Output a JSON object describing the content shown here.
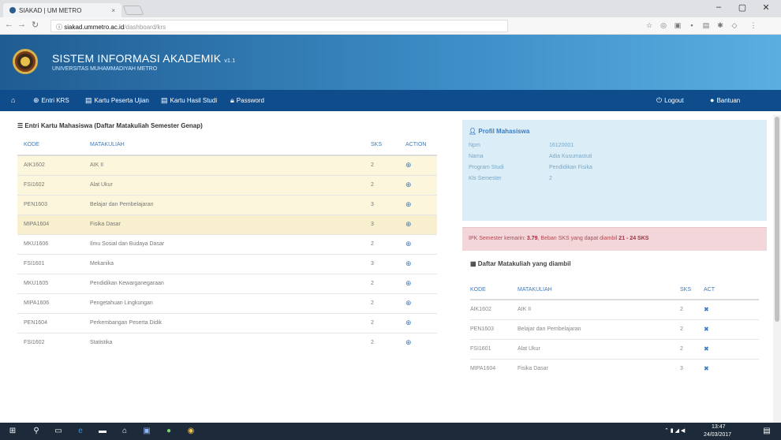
{
  "browser": {
    "tab_title": "SIAKAD | UM METRO",
    "tab_close": "×",
    "url_host": "siakad.ummetro.ac.id",
    "url_path": "/dashboard/krs",
    "win_min": "–",
    "win_max": "▢",
    "win_close": "✕"
  },
  "header": {
    "title": "SISTEM INFORMASI AKADEMIK",
    "version": "v1.1",
    "subtitle": "UNIVERSITAS MUHAMMADIYAH METRO"
  },
  "nav": {
    "home_icon": "home-icon",
    "items": [
      {
        "label": "Entri KRS",
        "icon": "plus-circle-icon"
      },
      {
        "label": "Kartu Peserta Ujian",
        "icon": "card-icon"
      },
      {
        "label": "Kartu Hasil Studi",
        "icon": "card-icon"
      },
      {
        "label": "Password",
        "icon": "lock-icon"
      }
    ],
    "right_items": [
      {
        "label": "Logout",
        "icon": "logout-icon"
      },
      {
        "label": "Bantuan",
        "icon": "help-icon"
      }
    ]
  },
  "krs_panel": {
    "title": "Entri Kartu Mahasiswa (Daftar Matakuliah Semester Genap)",
    "columns": [
      "KODE",
      "MATAKULIAH",
      "SKS",
      "ACTION"
    ],
    "rows": [
      {
        "kode": "AIK1602",
        "matakuliah": "AIK II",
        "sks": "2",
        "highlight": "hl"
      },
      {
        "kode": "FSI1602",
        "matakuliah": "Alat Ukur",
        "sks": "2",
        "highlight": "hl"
      },
      {
        "kode": "PEN1603",
        "matakuliah": "Belajar dan Pembelajaran",
        "sks": "3",
        "highlight": "hl"
      },
      {
        "kode": "MIPA1604",
        "matakuliah": "Fisika Dasar",
        "sks": "3",
        "highlight": "hl2"
      },
      {
        "kode": "MKU1606",
        "matakuliah": "Ilmu Sosial dan Budaya Dasar",
        "sks": "2",
        "highlight": ""
      },
      {
        "kode": "FSI1601",
        "matakuliah": "Mekanika",
        "sks": "3",
        "highlight": ""
      },
      {
        "kode": "MKU1605",
        "matakuliah": "Pendidikan Kewarganegaraan",
        "sks": "2",
        "highlight": ""
      },
      {
        "kode": "MIPA1606",
        "matakuliah": "Pengetahuan Lingkungan",
        "sks": "2",
        "highlight": ""
      },
      {
        "kode": "PEN1604",
        "matakuliah": "Perkembangan Peserta Didik",
        "sks": "2",
        "highlight": ""
      },
      {
        "kode": "FSI1602",
        "matakuliah": "Statistika",
        "sks": "2",
        "highlight": ""
      }
    ]
  },
  "profile": {
    "title": "Profil Mahasiswa",
    "fields": [
      {
        "key": "Npm",
        "value": "16120001"
      },
      {
        "key": "Nama",
        "value": "Adia Kusumastuti"
      },
      {
        "key": "Program Studi",
        "value": "Pendidikan Fisika"
      },
      {
        "key": "Kls Semester",
        "value": "2"
      }
    ]
  },
  "alert": {
    "prefix": "IPK Semester kemarin:",
    "ipk": "3.79",
    "middle": ", Beban SKS yang dapat diambil",
    "sks": "21 - 24 SKS"
  },
  "taken": {
    "title": "Daftar Matakuliah yang diambil",
    "columns": [
      "KODE",
      "MATAKULIAH",
      "SKS",
      "ACT"
    ],
    "rows": [
      {
        "kode": "AIK1602",
        "matakuliah": "AIK II",
        "sks": "2"
      },
      {
        "kode": "PEN1603",
        "matakuliah": "Belajar dan Pembelajaran",
        "sks": "2"
      },
      {
        "kode": "FSI1601",
        "matakuliah": "Alat Ukur",
        "sks": "2"
      },
      {
        "kode": "MIPA1604",
        "matakuliah": "Fisika Dasar",
        "sks": "3"
      }
    ]
  },
  "taskbar": {
    "time": "13:47",
    "date": "24/03/2017"
  }
}
